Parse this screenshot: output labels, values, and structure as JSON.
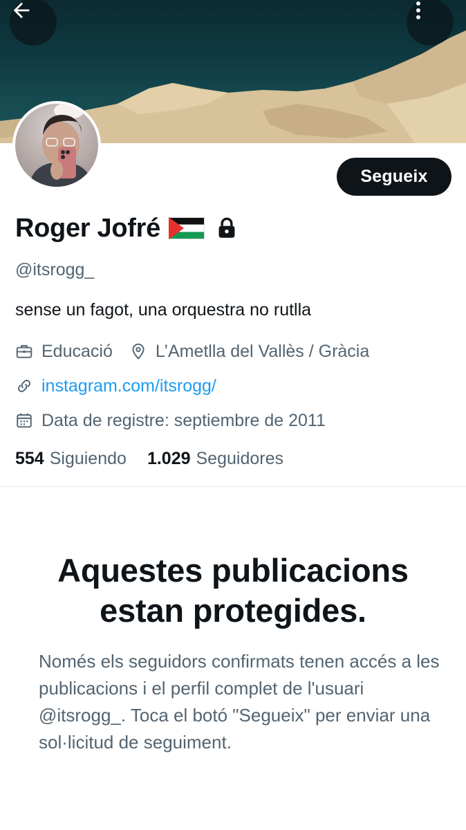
{
  "banner": {
    "back_icon": "arrow-left-icon",
    "more_icon": "vertical-ellipsis-icon"
  },
  "profile": {
    "display_name": "Roger Jofré",
    "flag_icon": "palestine-flag-icon",
    "protected_icon": "lock-icon",
    "handle": "@itsrogg_",
    "bio": "sense un fagot, una orquestra no rutlla",
    "professional_category": "Educació",
    "location": "L’Ametlla del Vallès / Gràcia",
    "website": "instagram.com/itsrogg/",
    "join_date": "Data de registre: septiembre de 2011",
    "following_count": "554",
    "following_label": "Siguiendo",
    "followers_count": "1.029",
    "followers_label": "Seguidores"
  },
  "follow_button": {
    "label": "Segueix"
  },
  "protected_notice": {
    "title_line1": "Aquestes publicacions",
    "title_line2": "estan protegides.",
    "body": "Només els seguidors confirmats tenen accés a les publicacions i el perfil complet de l'usuari @itsrogg_. Toca el botó \"Segueix\" per enviar una sol·licitud de seguiment."
  },
  "colors": {
    "accent_link": "#1d9bf0",
    "primary_text": "#0f1419",
    "secondary_text": "#536471",
    "button_bg": "#0f1419"
  }
}
